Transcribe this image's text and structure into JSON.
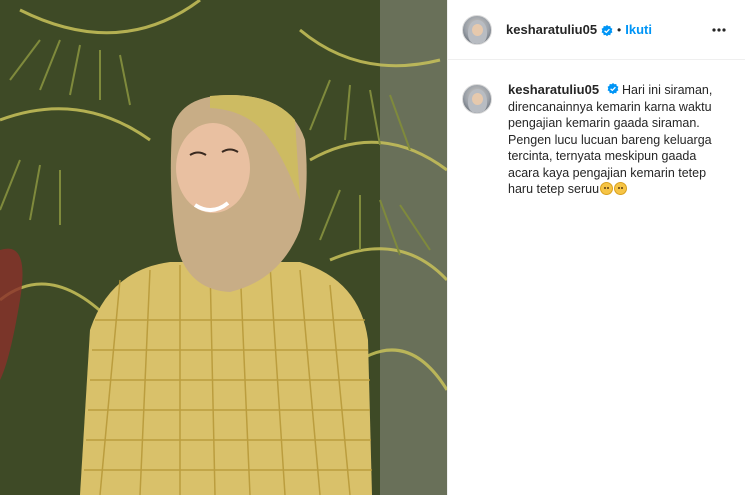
{
  "post": {
    "username": "kesharatuliu05",
    "separator": "•",
    "follow_label": "Ikuti",
    "caption": "Hari ini siraman, direncanainnya kemarin karna waktu pengajian kemarin gaada siraman. Pengen lucu lucuan bareng keluarga tercinta, ternyata meskipun gaada acara kaya pengajian kemarin tetep haru tetep seruu",
    "caption_emojis": [
      "pleading-face",
      "hugging-face"
    ]
  },
  "icons": {
    "verified": "verified-badge-icon",
    "more": "more-options-icon"
  },
  "colors": {
    "accent": "#0095f6",
    "text": "#262626",
    "border": "#efefef"
  }
}
